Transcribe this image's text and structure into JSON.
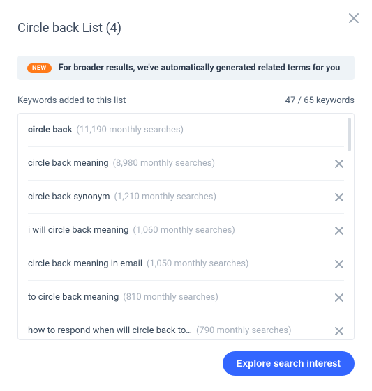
{
  "title": "Circle back List (4)",
  "banner": {
    "badge": "NEW",
    "text": "For broader results, we've automatically generated related terms for you"
  },
  "subhead": {
    "left": "Keywords added to this list",
    "right": "47 / 65 keywords"
  },
  "keywords": [
    {
      "term": "circle back",
      "meta": "(11,190 monthly searches)",
      "bold": true,
      "removable": false
    },
    {
      "term": "circle back meaning",
      "meta": "(8,980 monthly searches)",
      "bold": false,
      "removable": true
    },
    {
      "term": "circle back synonym",
      "meta": "(1,210 monthly searches)",
      "bold": false,
      "removable": true
    },
    {
      "term": "i will circle back meaning",
      "meta": "(1,060 monthly searches)",
      "bold": false,
      "removable": true
    },
    {
      "term": "circle back meaning in email",
      "meta": "(1,050 monthly searches)",
      "bold": false,
      "removable": true
    },
    {
      "term": "to circle back meaning",
      "meta": "(810 monthly searches)",
      "bold": false,
      "removable": true
    },
    {
      "term": "how to respond when will circle back to…",
      "meta": "(790 monthly searches)",
      "bold": false,
      "removable": true
    }
  ],
  "cta": "Explore search interest"
}
